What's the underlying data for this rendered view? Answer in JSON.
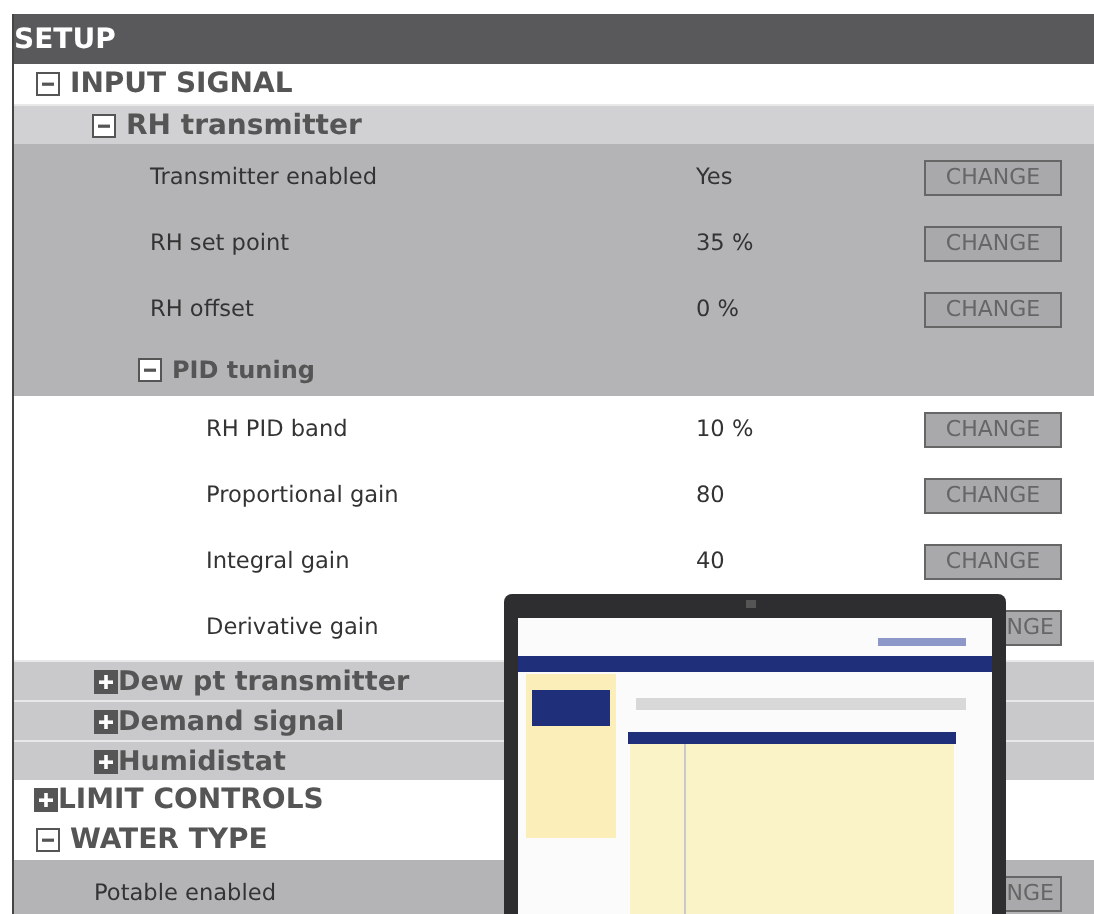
{
  "header": {
    "title": "SETUP"
  },
  "tree": [
    {
      "label": "INPUT SIGNAL",
      "expanded": true,
      "children": [
        {
          "label": "RH transmitter",
          "expanded": true,
          "settings": [
            {
              "name": "Transmitter enabled",
              "value": "Yes",
              "button": "CHANGE",
              "covered": false
            },
            {
              "name": "RH set point",
              "value": "35 %",
              "button": "CHANGE",
              "covered": false
            },
            {
              "name": "RH offset",
              "value": "0 %",
              "button": "CHANGE",
              "covered": false
            }
          ],
          "children": [
            {
              "label": "PID tuning",
              "expanded": true,
              "settings": [
                {
                  "name": "RH PID band",
                  "value": "10 %",
                  "button": "CHANGE",
                  "covered": false
                },
                {
                  "name": "Proportional gain",
                  "value": "80",
                  "button": "CHANGE",
                  "covered": false
                },
                {
                  "name": "Integral gain",
                  "value": "40",
                  "button": "CHANGE",
                  "covered": false
                },
                {
                  "name": "Derivative gain",
                  "button": "NGE",
                  "covered": true
                }
              ]
            }
          ]
        },
        {
          "label": "Dew pt transmitter",
          "expanded": false
        },
        {
          "label": "Demand signal",
          "expanded": false
        },
        {
          "label": "Humidistat",
          "expanded": false
        }
      ]
    },
    {
      "label": "LIMIT CONTROLS",
      "expanded": false
    },
    {
      "label": "WATER TYPE",
      "expanded": true,
      "settings": [
        {
          "name": "Potable enabled",
          "button": "NGE",
          "covered": true
        }
      ]
    }
  ]
}
